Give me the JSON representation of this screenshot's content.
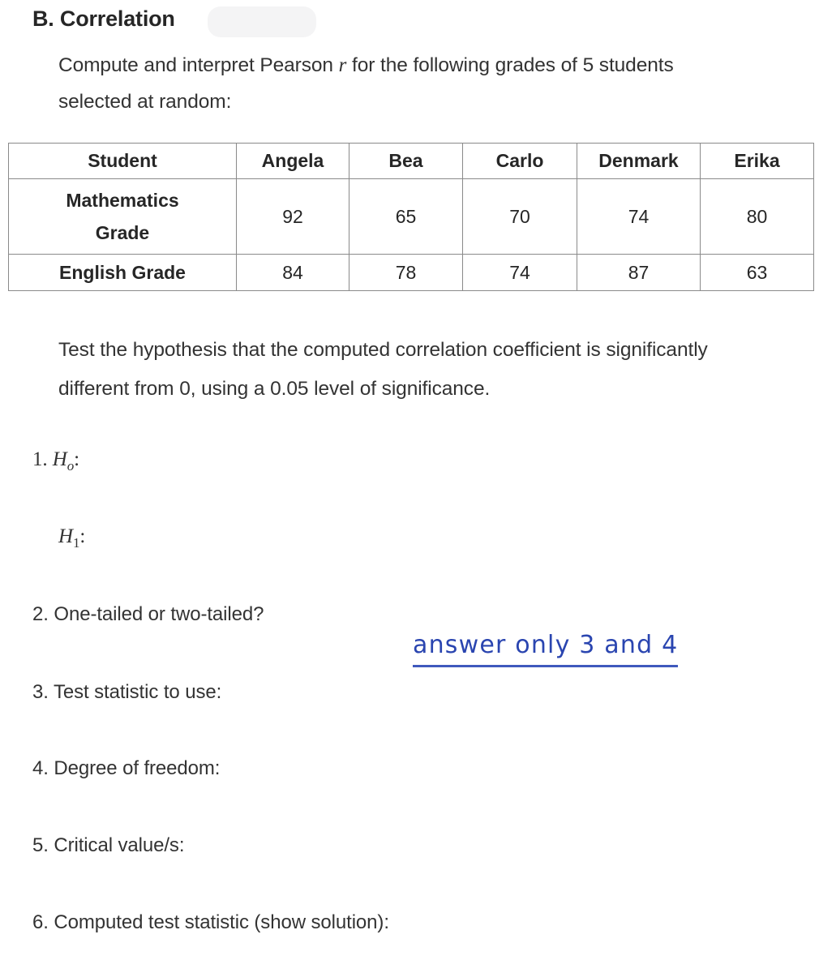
{
  "heading": "B. Correlation",
  "intro": {
    "before_var": "Compute and interpret Pearson ",
    "variable": "r",
    "after_var": " for the following grades of 5 students selected at random:"
  },
  "table": {
    "header": [
      "Student",
      "Angela",
      "Bea",
      "Carlo",
      "Denmark",
      "Erika"
    ],
    "rows": [
      {
        "label": "Mathematics Grade",
        "label_line1": "Mathematics",
        "label_line2": "Grade",
        "values": [
          "92",
          "65",
          "70",
          "74",
          "80"
        ]
      },
      {
        "label": "English Grade",
        "values": [
          "84",
          "78",
          "74",
          "87",
          "63"
        ]
      }
    ]
  },
  "test_paragraph": "Test the hypothesis that the computed correlation coefficient is significantly different from 0, using a 0.05 level of significance.",
  "questions": {
    "q1_number": "1.",
    "q1_symbol": "H",
    "q1_subscript": "o",
    "q1_colon": ":",
    "q1_alt_symbol": "H",
    "q1_alt_subscript": "1",
    "q1_alt_colon": ":",
    "q2": "2. One-tailed or two-tailed?",
    "q3": "3. Test statistic to use:",
    "q4": "4. Degree of freedom:",
    "q5": "5. Critical value/s:",
    "q6": "6. Computed test statistic (show solution):"
  },
  "annotation": {
    "text": "answer only 3 and 4",
    "color": "#2a45b0"
  },
  "colors": {
    "text": "#333333",
    "heading": "#262626",
    "table_border": "#8a8a8a",
    "annotation_blue": "#2a45b0",
    "background": "#ffffff"
  }
}
